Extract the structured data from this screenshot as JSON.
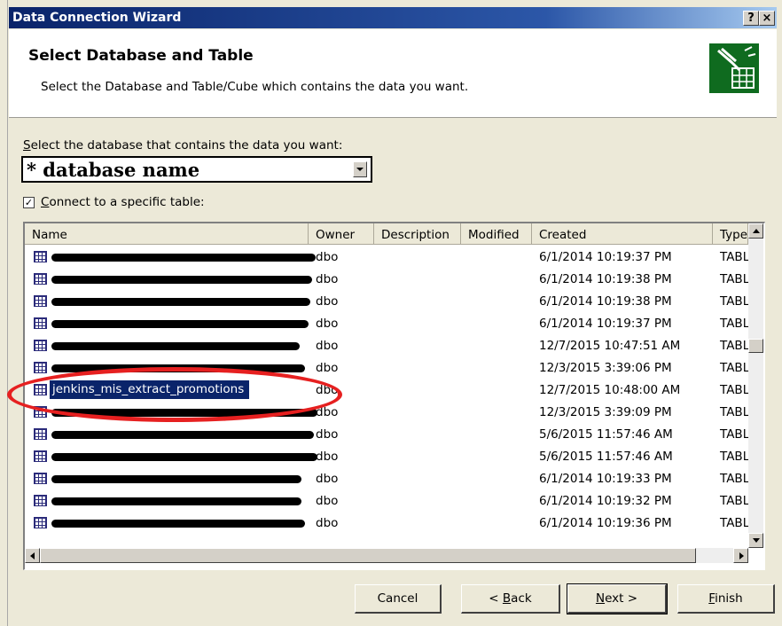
{
  "window": {
    "title": "Data Connection Wizard",
    "help_label": "?",
    "close_label": "×"
  },
  "header": {
    "title": "Select Database and Table",
    "subtitle": "Select the Database and Table/Cube which contains the data you want."
  },
  "database": {
    "label_accel": "S",
    "label_rest": "elect the database that contains the data you want:",
    "value": "* database name"
  },
  "connect_table": {
    "checked": true,
    "check_mark": "✓",
    "label_accel": "C",
    "label_rest": "onnect to a specific table:"
  },
  "table_list": {
    "columns": [
      "Name",
      "Owner",
      "Description",
      "Modified",
      "Created",
      "Type"
    ],
    "rows": [
      {
        "name": "",
        "owner": "dbo",
        "created": "6/1/2014 10:19:37 PM",
        "type": "TABL"
      },
      {
        "name": "",
        "owner": "dbo",
        "created": "6/1/2014 10:19:38 PM",
        "type": "TABL"
      },
      {
        "name": "",
        "owner": "dbo",
        "created": "6/1/2014 10:19:38 PM",
        "type": "TABL"
      },
      {
        "name": "",
        "owner": "dbo",
        "created": "6/1/2014 10:19:37 PM",
        "type": "TABL"
      },
      {
        "name": "",
        "owner": "dbo",
        "created": "12/7/2015 10:47:51 AM",
        "type": "TABL"
      },
      {
        "name": "",
        "owner": "dbo",
        "created": "12/3/2015 3:39:06 PM",
        "type": "TABL"
      },
      {
        "name": "jenkins_mis_extract_promotions",
        "owner": "dbo",
        "created": "12/7/2015 10:48:00 AM",
        "type": "TABL",
        "selected": true
      },
      {
        "name": "",
        "owner": "dbo",
        "created": "12/3/2015 3:39:09 PM",
        "type": "TABL"
      },
      {
        "name": "",
        "owner": "dbo",
        "created": "5/6/2015 11:57:46 AM",
        "type": "TABL"
      },
      {
        "name": "",
        "owner": "dbo",
        "created": "5/6/2015 11:57:46 AM",
        "type": "TABL"
      },
      {
        "name": "",
        "owner": "dbo",
        "created": "6/1/2014 10:19:33 PM",
        "type": "TABL"
      },
      {
        "name": "",
        "owner": "dbo",
        "created": "6/1/2014 10:19:32 PM",
        "type": "TABL"
      },
      {
        "name": "",
        "owner": "dbo",
        "created": "6/1/2014 10:19:36 PM",
        "type": "TABL"
      }
    ]
  },
  "buttons": {
    "cancel": "Cancel",
    "back_pre": "< ",
    "back_accel": "B",
    "back_rest": "ack",
    "next_accel": "N",
    "next_rest": "ext >",
    "finish_accel": "F",
    "finish_rest": "inish"
  },
  "annotation_color": "#e62020"
}
